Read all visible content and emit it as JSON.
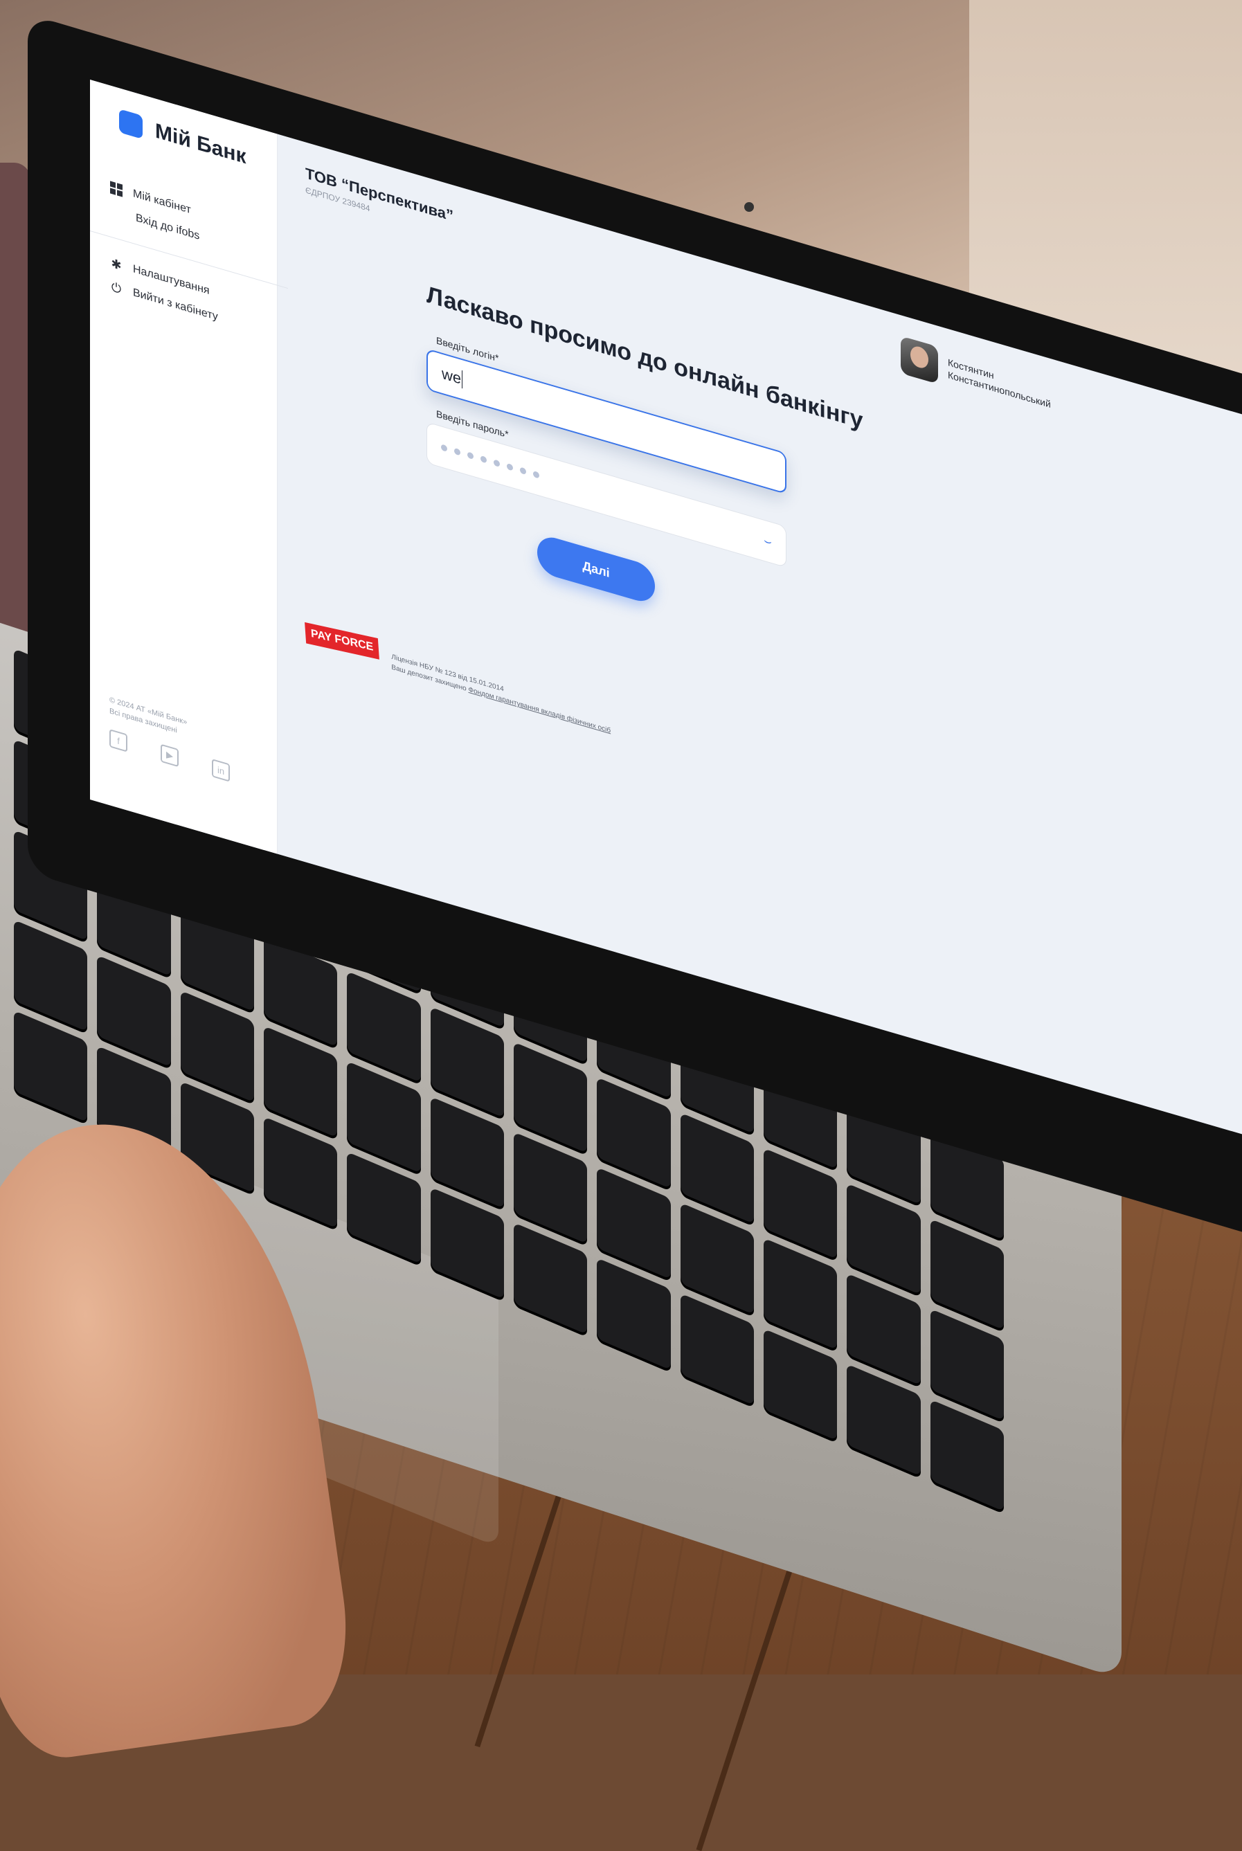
{
  "brand": {
    "name": "Мій Банк",
    "accent": "#2d74f2"
  },
  "sidebar": {
    "items": [
      {
        "label": "Мій кабінет",
        "icon": "dashboard-icon"
      },
      {
        "label": "Вхід до ifobs",
        "icon": null
      }
    ],
    "secondary": [
      {
        "label": "Налаштування",
        "icon": "gear-icon"
      },
      {
        "label": "Вийти з кабінету",
        "icon": "power-icon"
      }
    ],
    "footer_copy_line1": "© 2024 АТ «Мій Банк»",
    "footer_copy_line2": "Всі права захищені",
    "socials": [
      "facebook-icon",
      "youtube-icon",
      "linkedin-icon"
    ]
  },
  "header": {
    "company_name": "ТОВ “Перспектива”",
    "company_code": "ЄДРПОУ 239484"
  },
  "user": {
    "first_name": "Костянтин",
    "last_name": "Константинопольський"
  },
  "login_form": {
    "title": "Ласкаво просимо до онлайн банкінгу",
    "login_label": "Введіть логін*",
    "login_value": "we",
    "password_label": "Введіть пароль*",
    "password_mask_length": 8,
    "submit_label": "Далі"
  },
  "footer": {
    "logo_text": "PAY FORCE",
    "license_line": "Ліцензія НБУ № 123 від 15.01.2014",
    "deposit_prefix": "Ваш депозит захищено ",
    "deposit_link": "Фондом гарантування вкладів фізичних осіб"
  },
  "colors": {
    "accent": "#3d78f0",
    "input_focus": "#3a74e8",
    "pay_force_red": "#e3262b",
    "screen_bg": "#edf1f7"
  }
}
